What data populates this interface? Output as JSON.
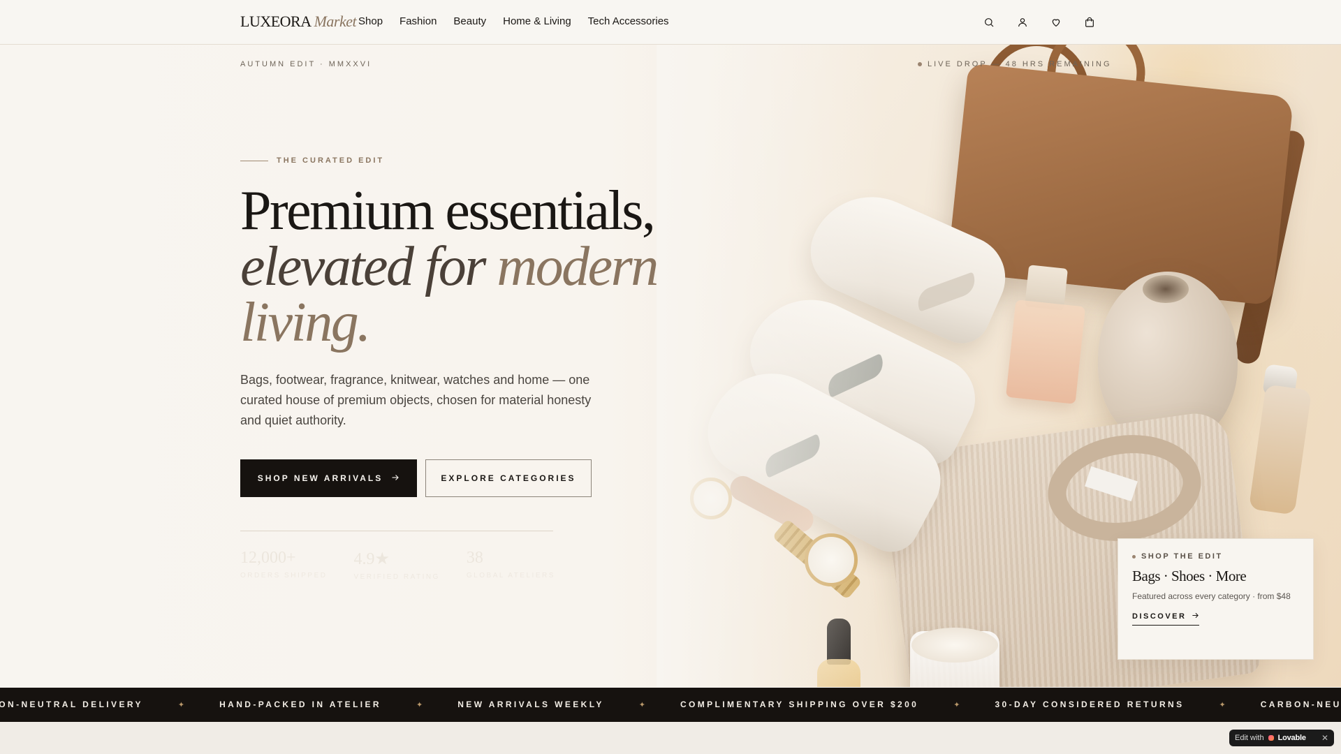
{
  "header": {
    "logo_main": "LUXEORA",
    "logo_sub": "Market",
    "nav": [
      {
        "label": "Shop"
      },
      {
        "label": "Fashion"
      },
      {
        "label": "Beauty"
      },
      {
        "label": "Home & Living"
      },
      {
        "label": "Tech Accessories"
      }
    ],
    "icons": [
      "search-icon",
      "user-icon",
      "heart-icon",
      "shopping-bag-icon"
    ]
  },
  "hero": {
    "eyebrow_top": "AUTUMN EDIT · MMXXVI",
    "live_drop": "LIVE DROP — 48 HRS REMAINING",
    "curated_label": "THE CURATED EDIT",
    "headline_l1": "Premium essentials,",
    "headline_l2a": "elevated for ",
    "headline_l2b": "modern",
    "headline_l3": "living.",
    "description": "Bags, footwear, fragrance, knitwear, watches and home — one curated house of premium objects, chosen for material honesty and quiet authority.",
    "primary_cta": "SHOP NEW ARRIVALS",
    "primary_cta_icon": "arrow-right-icon",
    "secondary_cta": "EXPLORE CATEGORIES",
    "stats": [
      {
        "value": "12,000+",
        "label": "ORDERS SHIPPED"
      },
      {
        "value": "4.9★",
        "label": "VERIFIED RATING"
      },
      {
        "value": "38",
        "label": "GLOBAL ATELIERS"
      }
    ]
  },
  "edit_card": {
    "kicker": "SHOP THE EDIT",
    "title": "Bags · Shoes · More",
    "description": "Featured across every category · from $48",
    "cta": "DISCOVER"
  },
  "marquee": {
    "items": [
      "CARBON-NEUTRAL DELIVERY",
      "HAND-PACKED IN ATELIER",
      "NEW ARRIVALS WEEKLY",
      "COMPLIMENTARY SHIPPING OVER $200",
      "30-DAY CONSIDERED RETURNS",
      "CARBON-NEUTRAL DELIVERY"
    ],
    "separator": "✦"
  },
  "lovable": {
    "prefix": "Edit with",
    "brand": "Lovable",
    "close": "✕"
  },
  "colors": {
    "background": "#f8f5f0",
    "ink": "#1a1714",
    "accent": "#8a7560",
    "marquee_bg": "#16120f"
  }
}
